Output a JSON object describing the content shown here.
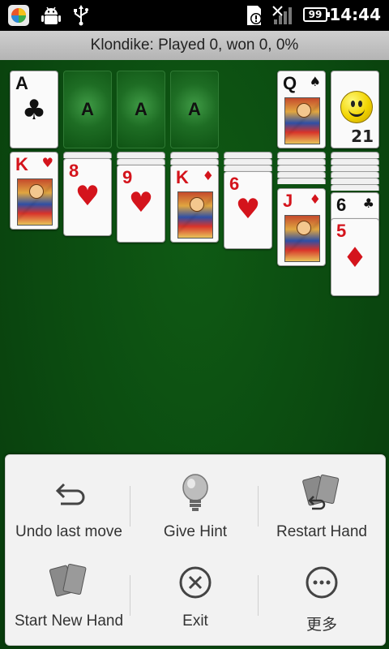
{
  "statusbar": {
    "battery": "99",
    "time": "14:44"
  },
  "title": "Klondike:  Played 0, won 0, 0%",
  "foundations": [
    {
      "rank": "A",
      "suit": "♣",
      "color": "black",
      "type": "card"
    },
    {
      "rank": "A",
      "type": "empty"
    },
    {
      "rank": "A",
      "type": "empty"
    },
    {
      "rank": "A",
      "type": "empty"
    }
  ],
  "waste": {
    "rank": "Q",
    "suit": "♠",
    "color": "black"
  },
  "stock": {
    "count": "21"
  },
  "tableau": [
    {
      "rank": "K",
      "suit": "♥",
      "color": "red"
    },
    {
      "rank": "8",
      "suit": "♥",
      "color": "red"
    },
    {
      "rank": "9",
      "suit": "♥",
      "color": "red"
    },
    {
      "rank": "K",
      "suit": "♦",
      "color": "red"
    },
    {
      "rank": "6",
      "suit": "♥",
      "color": "red"
    },
    {
      "rank": "J",
      "suit": "♦",
      "color": "red"
    },
    {
      "rank": "6",
      "suit": "♣",
      "color": "black"
    },
    {
      "rank": "5",
      "suit": "♦",
      "color": "red"
    }
  ],
  "menu": {
    "undo": "Undo last move",
    "hint": "Give Hint",
    "restart": "Restart Hand",
    "new_hand": "Start New Hand",
    "exit": "Exit",
    "more": "更多"
  }
}
